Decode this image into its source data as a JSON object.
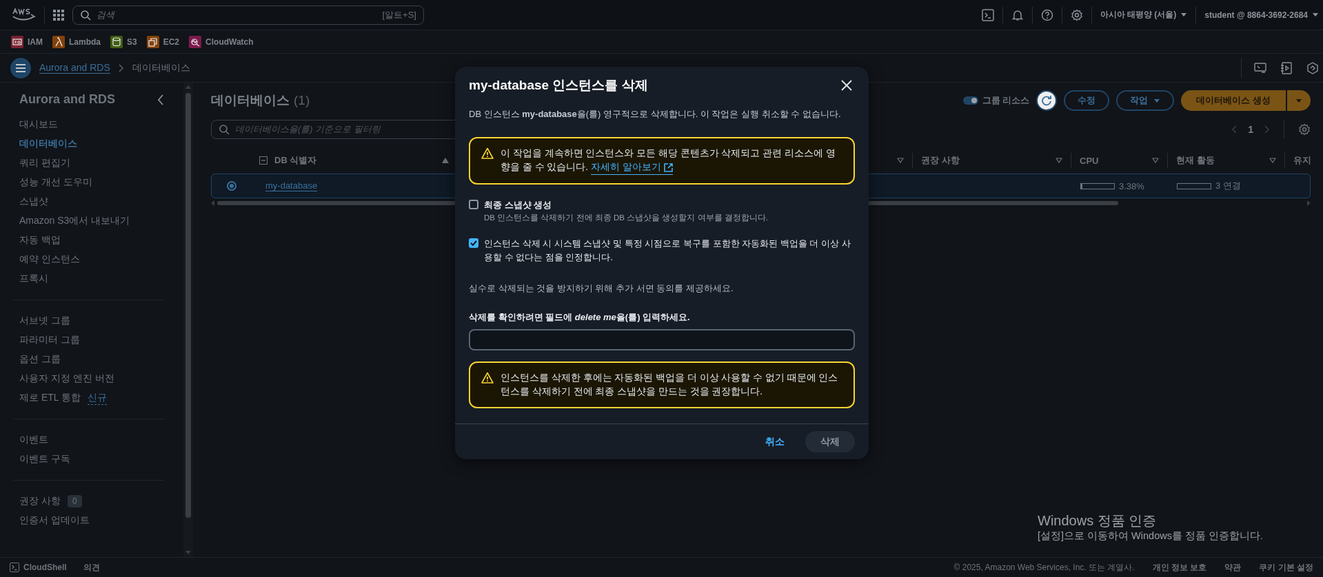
{
  "top_bar": {
    "search_placeholder": "검색",
    "search_shortcut": "[알트+S]",
    "region": "아시아 태평양 (서울)",
    "account": "student @ 8864-3692-2684"
  },
  "favorites": [
    {
      "label": "IAM",
      "color": "#7a2231"
    },
    {
      "label": "Lambda",
      "color": "#83420b"
    },
    {
      "label": "S3",
      "color": "#405d12"
    },
    {
      "label": "EC2",
      "color": "#83420b"
    },
    {
      "label": "CloudWatch",
      "color": "#7c1a4c"
    }
  ],
  "breadcrumb": [
    "Aurora and RDS",
    "데이터베이스"
  ],
  "sidebar": {
    "title": "Aurora and RDS",
    "groups": [
      {
        "items": [
          {
            "label": "대시보드",
            "selected": false
          },
          {
            "label": "데이터베이스",
            "selected": true
          },
          {
            "label": "쿼리 편집기",
            "selected": false
          },
          {
            "label": "성능 개선 도우미",
            "selected": false
          },
          {
            "label": "스냅샷",
            "selected": false
          },
          {
            "label": "Amazon S3에서 내보내기",
            "selected": false
          },
          {
            "label": "자동 백업",
            "selected": false
          },
          {
            "label": "예약 인스턴스",
            "selected": false
          },
          {
            "label": "프록시",
            "selected": false
          }
        ]
      },
      {
        "items": [
          {
            "label": "서브넷 그룹",
            "selected": false
          },
          {
            "label": "파라미터 그룹",
            "selected": false
          },
          {
            "label": "옵션 그룹",
            "selected": false
          },
          {
            "label": "사용자 지정 엔진 버전",
            "selected": false
          },
          {
            "label": "제로 ETL 통합",
            "selected": false,
            "tag": {
              "kind": "new",
              "text": "신규"
            }
          }
        ]
      },
      {
        "items": [
          {
            "label": "이벤트",
            "selected": false
          },
          {
            "label": "이벤트 구독",
            "selected": false
          }
        ]
      },
      {
        "items": [
          {
            "label": "권장 사항",
            "selected": false,
            "tag": {
              "kind": "count",
              "text": "0"
            }
          },
          {
            "label": "인증서 업데이트",
            "selected": false
          }
        ]
      }
    ]
  },
  "main": {
    "title": "데이터베이스",
    "count": "(1)",
    "group_resources": {
      "label": "그룹 리소스",
      "on": true
    },
    "edit_button": "수정",
    "actions_button": "작업",
    "create_button": "데이터베이스 생성",
    "filter_placeholder": "데이터베이스을(를) 기준으로 필터링",
    "page": "1",
    "table": {
      "columns": [
        {
          "label": "DB 식별자",
          "sorted": true
        },
        {
          "sorted": false
        },
        {
          "label": "권장 사항",
          "sorted": false
        },
        {
          "label": "CPU",
          "sorted": false
        },
        {
          "label": "현재 활동",
          "sorted": false
        },
        {
          "label": "유지"
        }
      ],
      "rows": [
        {
          "selected": true,
          "identifier": "my-database",
          "cpu": {
            "level": 0.0338,
            "reading": "3.38%"
          },
          "activity": {
            "level": 0,
            "reading": "3 연결"
          }
        }
      ]
    }
  },
  "modal": {
    "title": "my-database 인스턴스를 삭제",
    "description": "DB 인스턴스 **my-database**을(를) 영구적으로 삭제합니다. 이 작업은 실행 취소할 수 없습니다.",
    "warning": {
      "text": "이 작업을 계속하면 인스턴스와 모든 해당 콘텐츠가 삭제되고 관련 리소스에 영향을 줄 수 있습니다.",
      "link": "자세히 알아보기"
    },
    "checkboxes": [
      {
        "label": "최종 스냅샷 생성",
        "description": "DB 인스턴스를 삭제하기 전에 최종 DB 스냅샷을 생성할지 여부를 결정합니다.",
        "checked": false
      },
      {
        "label": "인스턴스 삭제 시 시스템 스냅샷 및 특정 시점으로 복구를 포함한 자동화된 백업을 더 이상 사용할 수 없다는 점을 인정합니다.",
        "checked": true
      }
    ],
    "consent_text": "실수로 삭제되는 것을 방지하기 위해 추가 서면 동의를 제공하세요.",
    "confirm_label": {
      "before": "삭제를 확인하려면 필드에 ",
      "keyword": "delete me",
      "after": "을(를) 입력하세요."
    },
    "recommendation": "인스턴스를 삭제한 후에는 자동화된 백업을 더 이상 사용할 수 없기 때문에 인스턴스를 삭제하기 전에 최종 스냅샷을 만드는 것을 권장합니다.",
    "cancel_button": "취소",
    "delete_button": {
      "label": "삭제",
      "disabled": true
    }
  },
  "footer": {
    "cloudshell": "CloudShell",
    "feedback": "의견",
    "copyright": "© 2025, Amazon Web Services, Inc. 또는 계열사.",
    "links": [
      "개인 정보 보호",
      "약관",
      "쿠키 기본 설정"
    ]
  },
  "os_notice": {
    "title": "Windows 정품 인증",
    "text": "[설정]으로 이동하여 Windows를 정품 인증합니다."
  }
}
